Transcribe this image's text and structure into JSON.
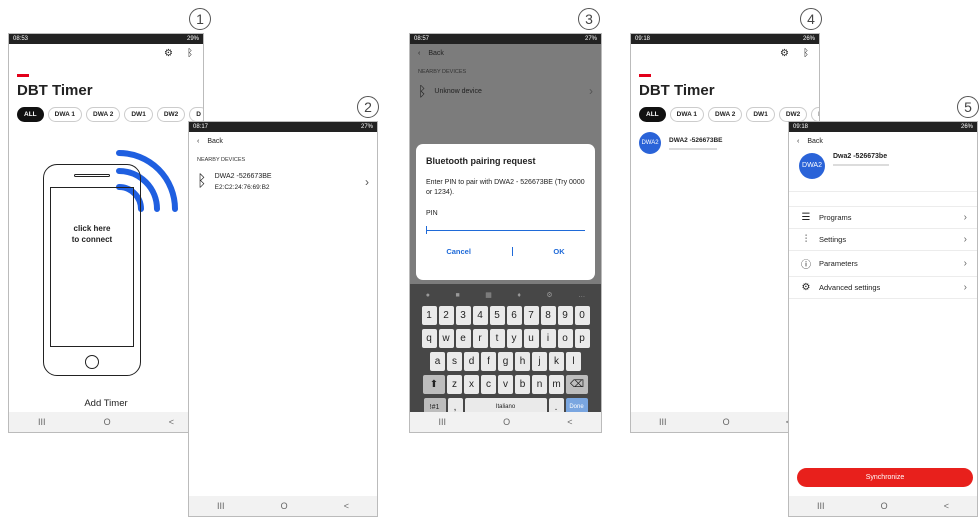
{
  "steps": [
    "1",
    "2",
    "3",
    "4",
    "5"
  ],
  "screen1": {
    "time": "08:53",
    "status_right": "29%",
    "title": "DBT Timer",
    "chips": [
      "ALL",
      "DWA 1",
      "DWA 2",
      "DW1",
      "DW2",
      "D"
    ],
    "phone_caption_line1": "click here",
    "phone_caption_line2": "to connect",
    "add_timer": "Add Timer",
    "nav": [
      "III",
      "O",
      "<"
    ]
  },
  "screen2": {
    "time": "08:17",
    "status_right": "27%",
    "back": "Back",
    "section": "NEARBY DEVICES",
    "device_name": "DWA2   -526673BE",
    "device_mac": "E2:C2:24:76:69:B2",
    "nav": [
      "III",
      "O",
      "<"
    ]
  },
  "screen3": {
    "time": "08:57",
    "status_right": "27%",
    "back": "Back",
    "section": "NEARBY DEVICES",
    "device_name": "Unknow device",
    "dialog_title": "Bluetooth pairing request",
    "dialog_text": "Enter PIN to pair with DWA2   - 526673BE (Try 0000 or 1234).",
    "pin_label": "PIN",
    "cancel": "Cancel",
    "ok": "OK",
    "kb_rows": [
      [
        "1",
        "2",
        "3",
        "4",
        "5",
        "6",
        "7",
        "8",
        "9",
        "0"
      ],
      [
        "q",
        "w",
        "e",
        "r",
        "t",
        "y",
        "u",
        "i",
        "o",
        "p"
      ],
      [
        "a",
        "s",
        "d",
        "f",
        "g",
        "h",
        "j",
        "k",
        "l"
      ],
      [
        "z",
        "x",
        "c",
        "v",
        "b",
        "n",
        "m"
      ]
    ],
    "kb_sym": "!#1",
    "kb_comma": ",",
    "kb_space": "Italiano",
    "kb_period": ".",
    "kb_done": "Done",
    "nav": [
      "III",
      "O",
      "<"
    ]
  },
  "screen4": {
    "time": "09:18",
    "status_right": "26%",
    "title": "DBT Timer",
    "chips": [
      "ALL",
      "DWA 1",
      "DWA 2",
      "DW1",
      "DW2",
      "D"
    ],
    "device_avatar": "DWA2",
    "device_name": "DWA2   -526673BE",
    "nav": [
      "III",
      "O",
      "<"
    ]
  },
  "screen5": {
    "time": "09:18",
    "status_right": "26%",
    "back": "Back",
    "device_avatar": "DWA2",
    "device_name": "Dwa2   -526673be",
    "menu": [
      "Programs",
      "Settings",
      "Parameters",
      "Advanced settings"
    ],
    "sync": "Synchronize",
    "nav": [
      "III",
      "O",
      "<"
    ]
  }
}
